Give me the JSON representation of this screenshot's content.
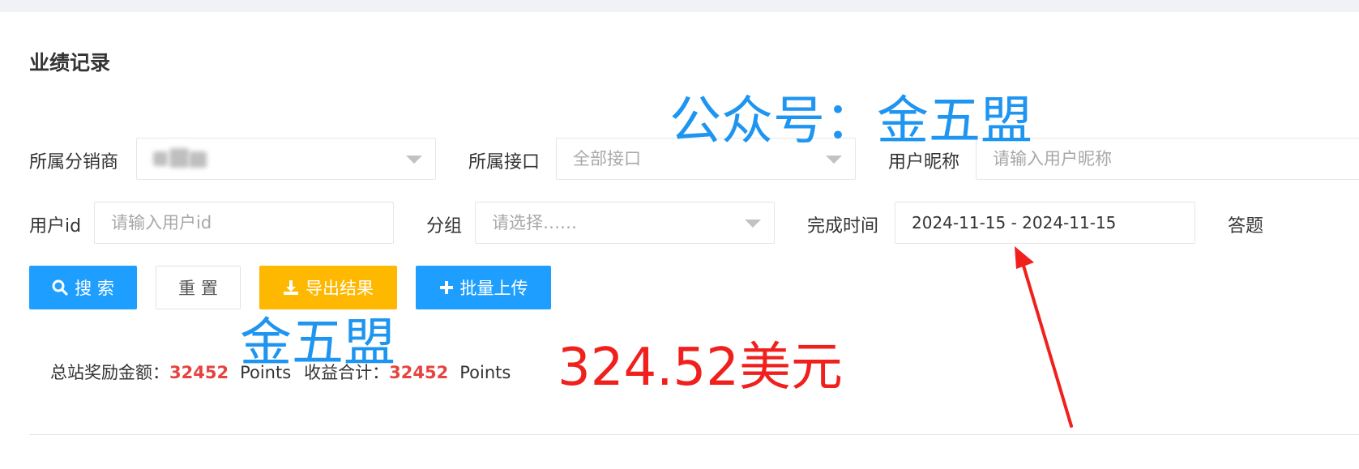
{
  "page": {
    "title": "业绩记录"
  },
  "filters": {
    "distributor": {
      "label": "所属分销商",
      "value": ""
    },
    "interface": {
      "label": "所属接口",
      "placeholder": "全部接口"
    },
    "nickname": {
      "label": "用户昵称",
      "placeholder": "请输入用户昵称"
    },
    "user_id": {
      "label": "用户id",
      "placeholder": "请输入用户id"
    },
    "group": {
      "label": "分组",
      "placeholder": "请选择……"
    },
    "finish_time": {
      "label": "完成时间",
      "value": "2024-11-15 - 2024-11-15"
    },
    "answer_partial": {
      "label": "答题"
    }
  },
  "buttons": {
    "search": "搜 索",
    "reset": "重 置",
    "export": "导出结果",
    "batch_upload": "批量上传"
  },
  "stats": {
    "reward_label": "总站奖励金额：",
    "reward_value": "32452",
    "reward_unit": "Points",
    "income_label": "收益合计：",
    "income_value": "32452",
    "income_unit": "Points"
  },
  "overlays": {
    "watermark_top": "公众号：金五盟",
    "watermark_mid": "金五盟",
    "usd_note": "324.52美元"
  },
  "colors": {
    "primary": "#1e9fff",
    "warning": "#ffb800",
    "stat_number": "#e64340",
    "watermark": "#1e95f0",
    "annotation_red": "#f0201d"
  }
}
